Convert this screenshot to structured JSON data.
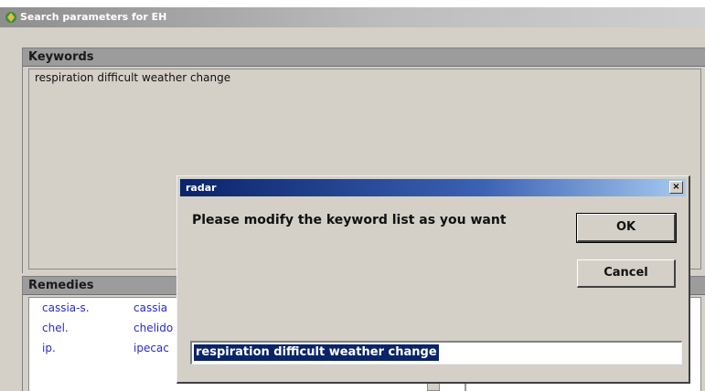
{
  "window": {
    "title": "Search parameters for EH"
  },
  "keywords": {
    "header": "Keywords",
    "text": "respiration difficult weather change"
  },
  "remedies": {
    "header": "Remedies",
    "items": [
      "cassia-s.",
      "cassia",
      "chel.",
      "chelido",
      "ip.",
      "ipecac"
    ]
  },
  "dialog": {
    "title": "radar",
    "close_glyph": "×",
    "message": "Please modify the keyword list as you want",
    "ok_label": "OK",
    "cancel_label": "Cancel",
    "input_value": "respiration difficult weather change"
  },
  "colors": {
    "dialog_titlebar": "#0a246a",
    "selection": "#0a246a",
    "remedy_link": "#2a2ad0",
    "panel_header": "#9c9c9c"
  }
}
